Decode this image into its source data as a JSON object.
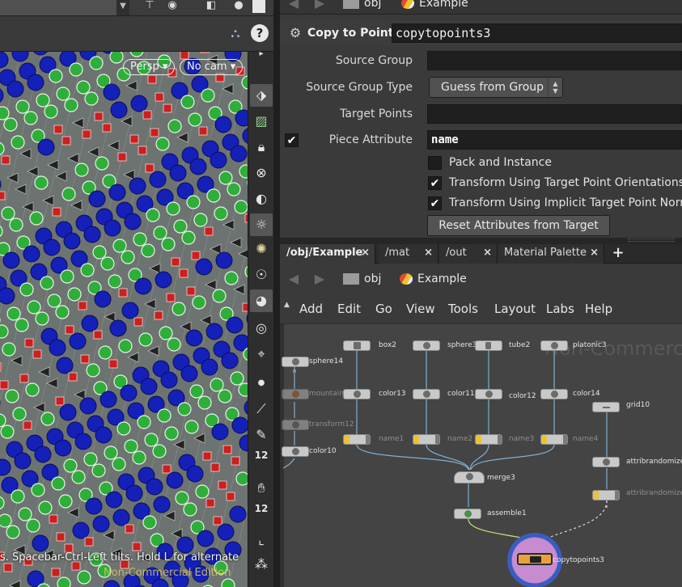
{
  "viewport": {
    "view_menu": "Persp",
    "camera_menu": "No cam",
    "status_text": "s. Spacebar-Ctrl-Left tilts. Hold L for alternate",
    "watermark": "Non-Commercial Edition",
    "toolbar": {
      "snap_count_1": "12",
      "snap_count_2": "12"
    }
  },
  "params": {
    "path": {
      "context": "obj",
      "network": "Example"
    },
    "op_type": "Copy to Points",
    "node_name": "copytopoints3",
    "fields": {
      "source_group_label": "Source Group",
      "source_group_value": "",
      "source_group_type_label": "Source Group Type",
      "source_group_type_value": "Guess from Group",
      "target_points_label": "Target Points",
      "target_points_value": "",
      "piece_attribute_label": "Piece Attribute",
      "piece_attribute_value": "name",
      "piece_attribute_enabled": true
    },
    "toggles": [
      {
        "label": "Pack and Instance",
        "checked": false
      },
      {
        "label": "Transform Using Target Point Orientations",
        "checked": true
      },
      {
        "label": "Transform Using Implicit Target Point Normals",
        "checked": true
      }
    ],
    "reset_button": "Reset Attributes from Target"
  },
  "network": {
    "tabs": [
      {
        "label": "/obj/Example",
        "active": true
      },
      {
        "label": "/mat",
        "active": false
      },
      {
        "label": "/out",
        "active": false
      },
      {
        "label": "Material Palette",
        "active": false
      }
    ],
    "tab_close": "×",
    "tab_add": "+",
    "path": {
      "context": "obj",
      "network": "Example"
    },
    "menu": [
      "Add",
      "Edit",
      "Go",
      "View",
      "Tools",
      "Layout",
      "Labs",
      "Help"
    ],
    "watermark": "Non-Commercial",
    "nodes": {
      "sphere14": "sphere14",
      "mountain": "mountain3",
      "transform12": "transform12",
      "color10": "color10",
      "box2": "box2",
      "color13": "color13",
      "name1": "name1",
      "sphere3": "sphere3",
      "color11": "color11",
      "name2": "name2",
      "tube2": "tube2",
      "color12": "color12",
      "name3": "name3",
      "platonic3": "platonic3",
      "color14": "color14",
      "name4": "name4",
      "merge3": "merge3",
      "assemble1": "assemble1",
      "grid10": "grid10",
      "attribrandomize_a": "attribrandomize_",
      "attribrandomize_b": "attribrandomize_",
      "copytopoints3": "copytopoints3"
    }
  },
  "colors": {
    "accent_selected": "#e9a23b",
    "instance_red": "#cc1f1f",
    "instance_green": "#2fae3a",
    "instance_blue": "#1420b8",
    "watermark_yellow": "#d9c760"
  }
}
